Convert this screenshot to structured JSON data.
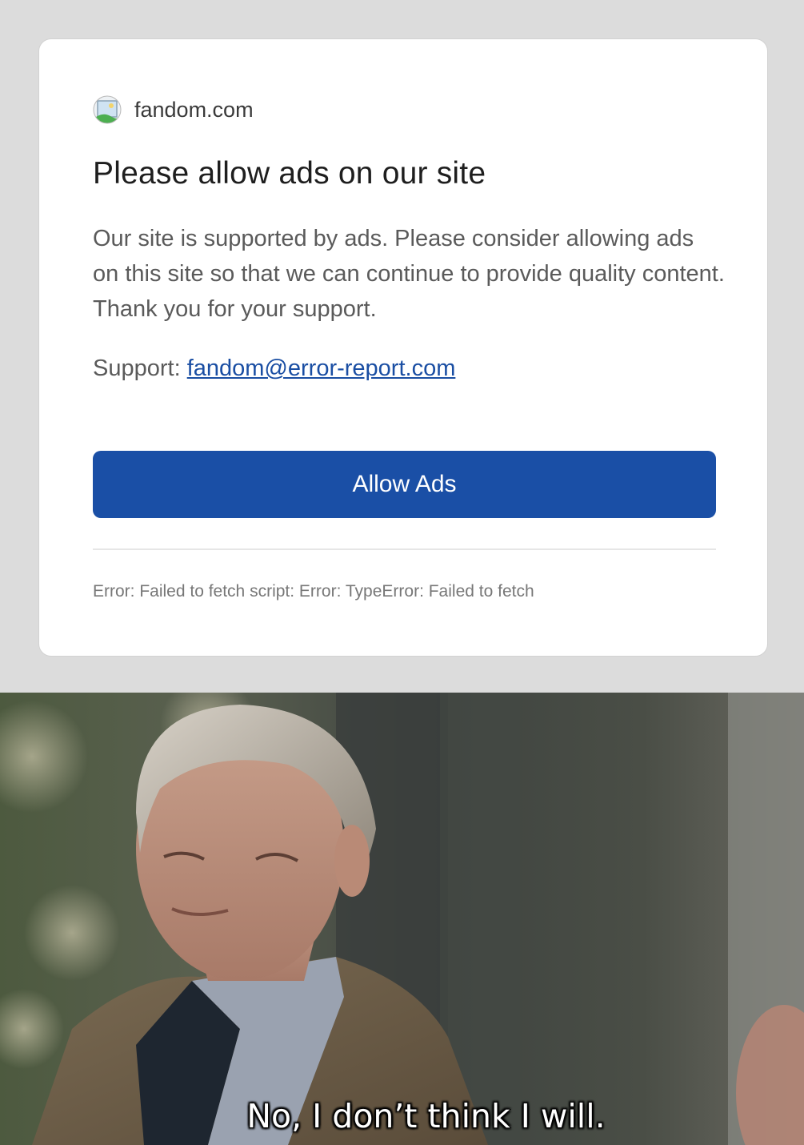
{
  "dialog": {
    "site_name": "fandom.com",
    "favicon_icon": "image-placeholder-icon",
    "title": "Please allow ads on our site",
    "body": "Our site is supported by ads. Please consider allowing ads on this site so that we can continue to provide quality content. Thank you for your support.",
    "support_label": "Support:",
    "support_email": "fandom@error-report.com",
    "allow_button_label": "Allow Ads",
    "error_text": "Error: Failed to fetch script: Error: TypeError: Failed to fetch"
  },
  "meme": {
    "caption": "No, I don’t think I will."
  },
  "colors": {
    "background": "#dcdcdc",
    "card": "#ffffff",
    "button": "#1a4fa6",
    "link": "#1a4ea3"
  }
}
